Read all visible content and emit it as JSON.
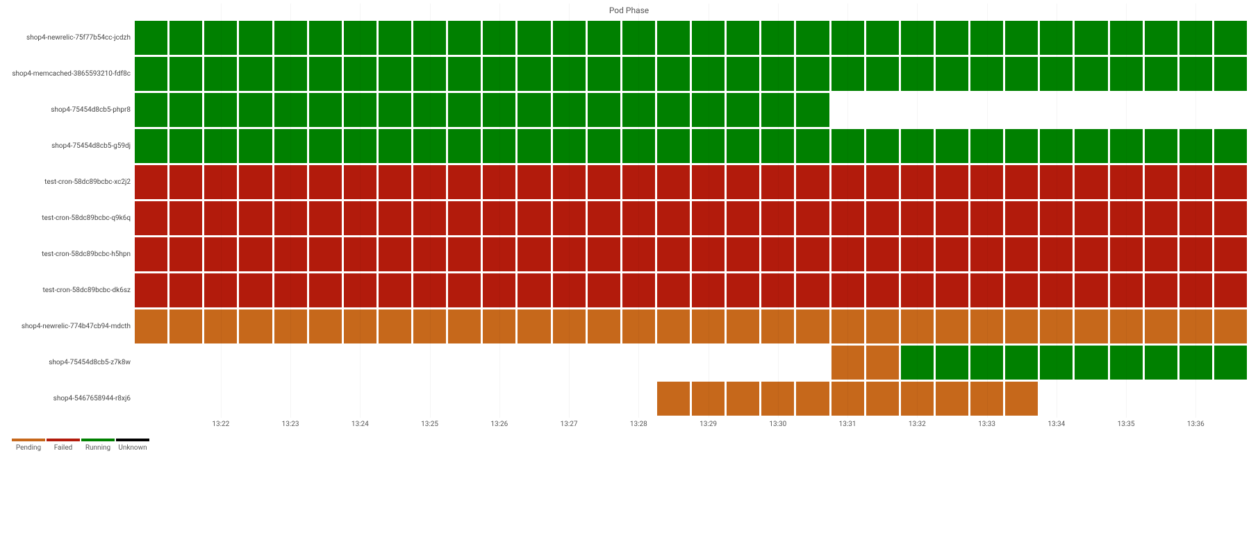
{
  "chart_data": {
    "type": "heatmap",
    "title": "Pod Phase",
    "x": [
      "13:21:00",
      "13:21:30",
      "13:22:00",
      "13:22:30",
      "13:23:00",
      "13:23:30",
      "13:24:00",
      "13:24:30",
      "13:25:00",
      "13:25:30",
      "13:26:00",
      "13:26:30",
      "13:27:00",
      "13:27:30",
      "13:28:00",
      "13:28:30",
      "13:29:00",
      "13:29:30",
      "13:30:00",
      "13:30:30",
      "13:31:00",
      "13:31:30",
      "13:32:00",
      "13:32:30",
      "13:33:00",
      "13:33:30",
      "13:34:00",
      "13:34:30",
      "13:35:00",
      "13:35:30",
      "13:36:00",
      "13:36:30"
    ],
    "x_ticks": {
      "2": "13:22",
      "4": "13:23",
      "6": "13:24",
      "8": "13:25",
      "10": "13:26",
      "12": "13:27",
      "14": "13:28",
      "16": "13:29",
      "18": "13:30",
      "20": "13:31",
      "22": "13:32",
      "24": "13:33",
      "26": "13:34",
      "28": "13:35",
      "30": "13:36"
    },
    "series": [
      {
        "name": "shop4-newrelic-75f77b54cc-jcdzh",
        "values": [
          "Running",
          "Running",
          "Running",
          "Running",
          "Running",
          "Running",
          "Running",
          "Running",
          "Running",
          "Running",
          "Running",
          "Running",
          "Running",
          "Running",
          "Running",
          "Running",
          "Running",
          "Running",
          "Running",
          "Running",
          "Running",
          "Running",
          "Running",
          "Running",
          "Running",
          "Running",
          "Running",
          "Running",
          "Running",
          "Running",
          "Running",
          "Running"
        ]
      },
      {
        "name": "shop4-memcached-3865593210-fdf8c",
        "values": [
          "Running",
          "Running",
          "Running",
          "Running",
          "Running",
          "Running",
          "Running",
          "Running",
          "Running",
          "Running",
          "Running",
          "Running",
          "Running",
          "Running",
          "Running",
          "Running",
          "Running",
          "Running",
          "Running",
          "Running",
          "Running",
          "Running",
          "Running",
          "Running",
          "Running",
          "Running",
          "Running",
          "Running",
          "Running",
          "Running",
          "Running",
          "Running"
        ]
      },
      {
        "name": "shop4-75454d8cb5-phpr8",
        "values": [
          "Running",
          "Running",
          "Running",
          "Running",
          "Running",
          "Running",
          "Running",
          "Running",
          "Running",
          "Running",
          "Running",
          "Running",
          "Running",
          "Running",
          "Running",
          "Running",
          "Running",
          "Running",
          "Running",
          "Running",
          null,
          null,
          null,
          null,
          null,
          null,
          null,
          null,
          null,
          null,
          null,
          null
        ]
      },
      {
        "name": "shop4-75454d8cb5-g59dj",
        "values": [
          "Running",
          "Running",
          "Running",
          "Running",
          "Running",
          "Running",
          "Running",
          "Running",
          "Running",
          "Running",
          "Running",
          "Running",
          "Running",
          "Running",
          "Running",
          "Running",
          "Running",
          "Running",
          "Running",
          "Running",
          "Running",
          "Running",
          "Running",
          "Running",
          "Running",
          "Running",
          "Running",
          "Running",
          "Running",
          "Running",
          "Running",
          "Running"
        ]
      },
      {
        "name": "test-cron-58dc89bcbc-xc2j2",
        "values": [
          "Failed",
          "Failed",
          "Failed",
          "Failed",
          "Failed",
          "Failed",
          "Failed",
          "Failed",
          "Failed",
          "Failed",
          "Failed",
          "Failed",
          "Failed",
          "Failed",
          "Failed",
          "Failed",
          "Failed",
          "Failed",
          "Failed",
          "Failed",
          "Failed",
          "Failed",
          "Failed",
          "Failed",
          "Failed",
          "Failed",
          "Failed",
          "Failed",
          "Failed",
          "Failed",
          "Failed",
          "Failed"
        ]
      },
      {
        "name": "test-cron-58dc89bcbc-q9k6q",
        "values": [
          "Failed",
          "Failed",
          "Failed",
          "Failed",
          "Failed",
          "Failed",
          "Failed",
          "Failed",
          "Failed",
          "Failed",
          "Failed",
          "Failed",
          "Failed",
          "Failed",
          "Failed",
          "Failed",
          "Failed",
          "Failed",
          "Failed",
          "Failed",
          "Failed",
          "Failed",
          "Failed",
          "Failed",
          "Failed",
          "Failed",
          "Failed",
          "Failed",
          "Failed",
          "Failed",
          "Failed",
          "Failed"
        ]
      },
      {
        "name": "test-cron-58dc89bcbc-h5hpn",
        "values": [
          "Failed",
          "Failed",
          "Failed",
          "Failed",
          "Failed",
          "Failed",
          "Failed",
          "Failed",
          "Failed",
          "Failed",
          "Failed",
          "Failed",
          "Failed",
          "Failed",
          "Failed",
          "Failed",
          "Failed",
          "Failed",
          "Failed",
          "Failed",
          "Failed",
          "Failed",
          "Failed",
          "Failed",
          "Failed",
          "Failed",
          "Failed",
          "Failed",
          "Failed",
          "Failed",
          "Failed",
          "Failed"
        ]
      },
      {
        "name": "test-cron-58dc89bcbc-dk6sz",
        "values": [
          "Failed",
          "Failed",
          "Failed",
          "Failed",
          "Failed",
          "Failed",
          "Failed",
          "Failed",
          "Failed",
          "Failed",
          "Failed",
          "Failed",
          "Failed",
          "Failed",
          "Failed",
          "Failed",
          "Failed",
          "Failed",
          "Failed",
          "Failed",
          "Failed",
          "Failed",
          "Failed",
          "Failed",
          "Failed",
          "Failed",
          "Failed",
          "Failed",
          "Failed",
          "Failed",
          "Failed",
          "Failed"
        ]
      },
      {
        "name": "shop4-newrelic-774b47cb94-mdcth",
        "values": [
          "Pending",
          "Pending",
          "Pending",
          "Pending",
          "Pending",
          "Pending",
          "Pending",
          "Pending",
          "Pending",
          "Pending",
          "Pending",
          "Pending",
          "Pending",
          "Pending",
          "Pending",
          "Pending",
          "Pending",
          "Pending",
          "Pending",
          "Pending",
          "Pending",
          "Pending",
          "Pending",
          "Pending",
          "Pending",
          "Pending",
          "Pending",
          "Pending",
          "Pending",
          "Pending",
          "Pending",
          "Pending"
        ]
      },
      {
        "name": "shop4-75454d8cb5-z7k8w",
        "values": [
          null,
          null,
          null,
          null,
          null,
          null,
          null,
          null,
          null,
          null,
          null,
          null,
          null,
          null,
          null,
          null,
          null,
          null,
          null,
          null,
          "Pending",
          "Pending",
          "Running",
          "Running",
          "Running",
          "Running",
          "Running",
          "Running",
          "Running",
          "Running",
          "Running",
          "Running"
        ]
      },
      {
        "name": "shop4-5467658944-r8xj6",
        "values": [
          null,
          null,
          null,
          null,
          null,
          null,
          null,
          null,
          null,
          null,
          null,
          null,
          null,
          null,
          null,
          "Pending",
          "Pending",
          "Pending",
          "Pending",
          "Pending",
          "Pending",
          "Pending",
          "Pending",
          "Pending",
          "Pending",
          "Pending",
          null,
          null,
          null,
          null,
          null,
          null
        ]
      }
    ],
    "legend": [
      {
        "label": "Pending",
        "color": "#c6681b"
      },
      {
        "label": "Failed",
        "color": "#b21b0c"
      },
      {
        "label": "Running",
        "color": "#008000"
      },
      {
        "label": "Unknown",
        "color": "#000000"
      }
    ]
  }
}
